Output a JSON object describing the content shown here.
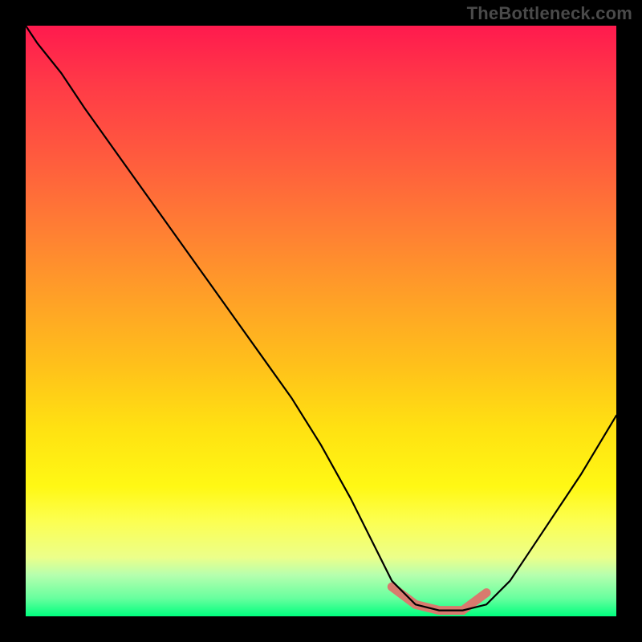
{
  "watermark": "TheBottleneck.com",
  "colors": {
    "background": "#000000",
    "gradient_top": "#ff1a4e",
    "gradient_bottom": "#00ff7e",
    "curve": "#000000",
    "highlight": "#d87a6e"
  },
  "chart_data": {
    "type": "line",
    "title": "",
    "xlabel": "",
    "ylabel": "",
    "xlim": [
      0,
      100
    ],
    "ylim": [
      0,
      100
    ],
    "series": [
      {
        "name": "bottleneck-curve",
        "x": [
          0,
          2,
          6,
          10,
          15,
          20,
          25,
          30,
          35,
          40,
          45,
          50,
          55,
          58,
          62,
          66,
          70,
          74,
          78,
          82,
          86,
          90,
          94,
          100
        ],
        "values": [
          100,
          97,
          92,
          86,
          79,
          72,
          65,
          58,
          51,
          44,
          37,
          29,
          20,
          14,
          6,
          2,
          1,
          1,
          2,
          6,
          12,
          18,
          24,
          34
        ]
      },
      {
        "name": "highlight-segment",
        "x": [
          62,
          66,
          70,
          74,
          78
        ],
        "values": [
          5,
          2,
          1,
          1,
          4
        ]
      }
    ]
  }
}
